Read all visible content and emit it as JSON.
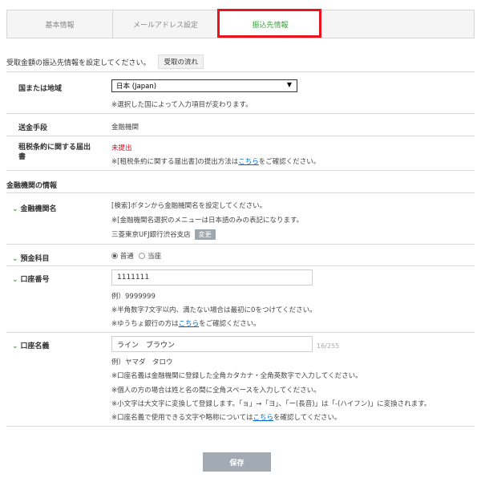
{
  "tabs": [
    {
      "label": "基本情報"
    },
    {
      "label": "メールアドレス設定"
    },
    {
      "label": "振込先情報"
    }
  ],
  "intro": {
    "text": "受取金額の振込先情報を設定してください。",
    "flow_button": "受取の流れ"
  },
  "country": {
    "label": "国または地域",
    "selected": "日本 (Japan)",
    "note": "※選択した国によって入力項目が変わります。"
  },
  "method": {
    "label": "送金手段",
    "value": "金融機関"
  },
  "tax": {
    "label_line1": "租税条約に関する届出",
    "label_line2": "書",
    "status": "未提出",
    "note_prefix": "※[租税条約に関する届出書]の提出方法は",
    "note_link": "こちら",
    "note_suffix": "をご確認ください。"
  },
  "bank_section": {
    "title": "金融機関の情報"
  },
  "bank_name": {
    "label": "金融機関名",
    "note1": "[検索]ボタンから金融機関名を設定してください。",
    "note2": "※[金融機関名選択のメニューは日本語のみの表記になります。",
    "value": "三菱東京UFJ銀行渋谷支店",
    "change_button": "変更"
  },
  "account_type": {
    "label": "預金科目",
    "option1": "普通",
    "option2": "当座"
  },
  "account_number": {
    "label": "口座番号",
    "value": "1111111",
    "example": "例）9999999",
    "note1": "※半角数字7文字以内、満たない場合は最初に0をつけてください。",
    "note2_prefix": "※ゆうちょ銀行の方は",
    "note2_link": "こちら",
    "note2_suffix": "をご確認ください。"
  },
  "account_name": {
    "label": "口座名義",
    "value": "ライン　ブラウン",
    "counter": "16/255",
    "example": "例）ヤマダ　タロウ",
    "note1": "※口座名義は金融機関に登録した全角カタカナ・全角英数字で入力してください。",
    "note2": "※個人の方の場合は姓と名の間に全角スペースを入力してください。",
    "note3": "※小文字は大文字に変換して登録します。「ョ」→「ヨ」、「ー(長音)」は「-(ハイフン)」に変換されます。",
    "note4_prefix": "※口座名義で使用できる文字や略称については",
    "note4_link": "こちら",
    "note4_suffix": "を確認してください。"
  },
  "save_button": "保存",
  "colors": {
    "active_tab": "#3aa33a",
    "highlight": "#e8141b",
    "link": "#0066cc",
    "warning": "#e60012",
    "chevron": "#2fa52f"
  }
}
